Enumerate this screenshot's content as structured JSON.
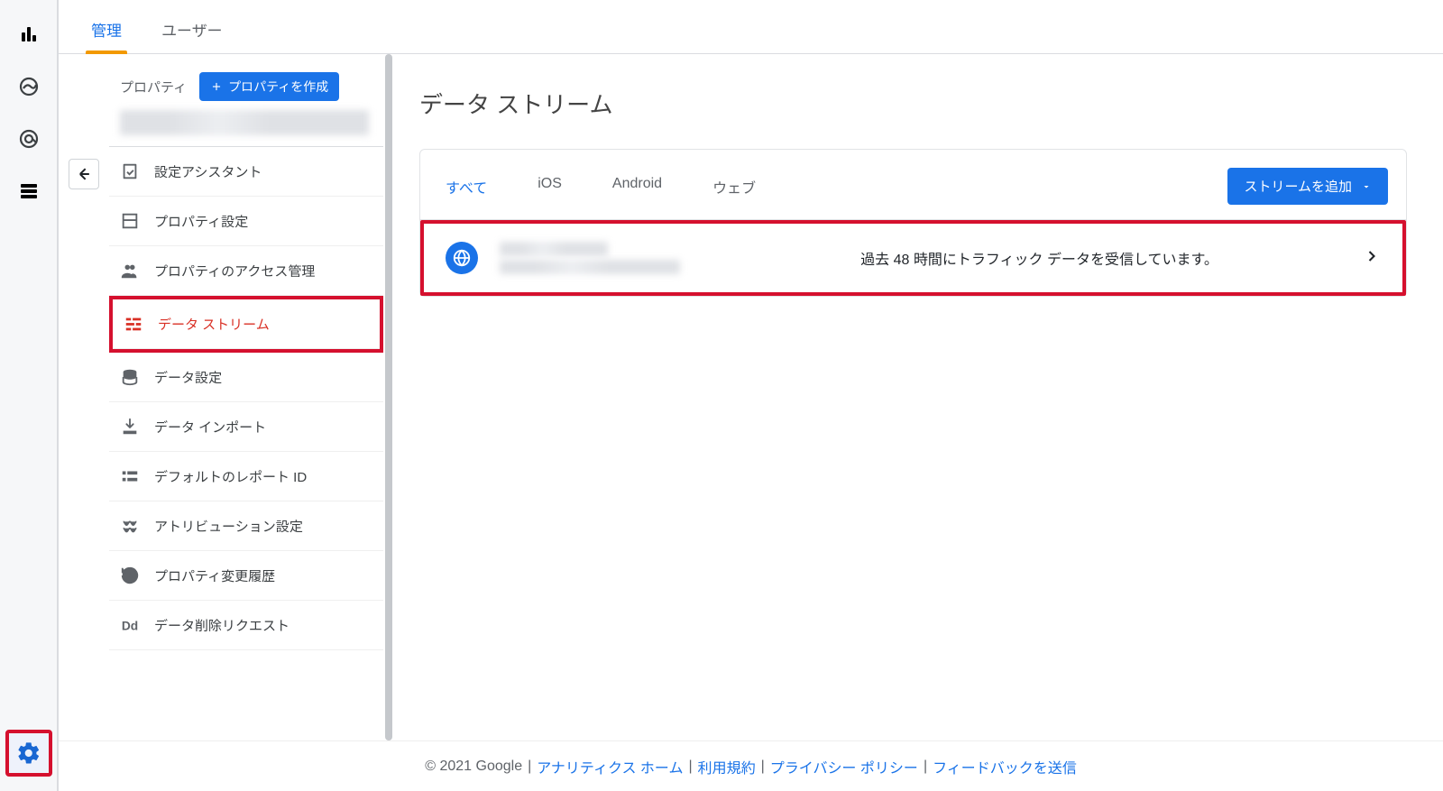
{
  "tabs": {
    "admin": "管理",
    "user": "ユーザー"
  },
  "property": {
    "label": "プロパティ",
    "create": "プロパティを作成"
  },
  "nav": {
    "setup": "設定アシスタント",
    "settings": "プロパティ設定",
    "access": "プロパティのアクセス管理",
    "streams": "データ ストリーム",
    "data": "データ設定",
    "import": "データ インポート",
    "report_id": "デフォルトのレポート ID",
    "attribution": "アトリビューション設定",
    "history": "プロパティ変更履歴",
    "delete_req": "データ削除リクエスト"
  },
  "page_title": "データ ストリーム",
  "filters": {
    "all": "すべて",
    "ios": "iOS",
    "android": "Android",
    "web": "ウェブ"
  },
  "add_stream": "ストリームを追加",
  "row_status": "過去 48 時間にトラフィック データを受信しています。",
  "footer": {
    "copyright": "© 2021 Google",
    "home": "アナリティクス ホーム",
    "terms": "利用規約",
    "privacy": "プライバシー ポリシー",
    "feedback": "フィードバックを送信"
  }
}
